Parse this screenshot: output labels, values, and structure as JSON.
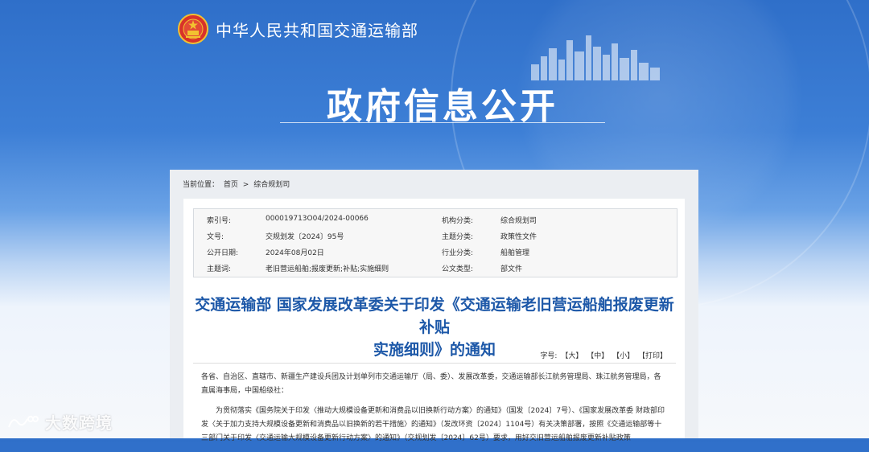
{
  "header": {
    "ministry_name": "中华人民共和国交通运输部",
    "hero_title": "政府信息公开"
  },
  "breadcrumb": {
    "label": "当前位置：",
    "items": [
      "首页",
      "综合规划司"
    ],
    "separator": ">"
  },
  "meta": {
    "rows": [
      {
        "k1": "索引号:",
        "v1": "000019713O04/2024-00066",
        "k2": "机构分类:",
        "v2": "综合规划司"
      },
      {
        "k1": "文号:",
        "v1": "交规划发〔2024〕95号",
        "k2": "主题分类:",
        "v2": "政策性文件"
      },
      {
        "k1": "公开日期:",
        "v1": "2024年08月02日",
        "k2": "行业分类:",
        "v2": "船舶管理"
      },
      {
        "k1": "主题词:",
        "v1": "老旧营运船舶;报废更新;补贴;实施细则",
        "k2": "公文类型:",
        "v2": "部文件"
      }
    ]
  },
  "document": {
    "title_line1": "交通运输部 国家发展改革委关于印发《交通运输老旧营运船舶报废更新补贴",
    "title_line2": "实施细则》的通知",
    "font_size_label": "字号:",
    "font_size_large": "【大】",
    "font_size_medium": "【中】",
    "font_size_small": "【小】",
    "print_label": "【打印】",
    "para1": "各省、自治区、直辖市、新疆生产建设兵团及计划单列市交通运输厅（局、委）、发展改革委，交通运输部长江航务管理局、珠江航务管理局，各直属海事局，中国船级社：",
    "para2": "为贯彻落实《国务院关于印发〈推动大规模设备更新和消费品以旧换新行动方案〉的通知》（国发〔2024〕7号）、《国家发展改革委 财政部印发〈关于加力支持大规模设备更新和消费品以旧换新的若干措施〉的通知》（发改环资〔2024〕1104号）有关决策部署，按照《交通运输部等十三部门关于印发〈交通运输大规模设备更新行动方案〉的通知》（交规划发〔2024〕62号）要求，用好交旧营运船舶报废更新补贴政策"
  },
  "watermark": {
    "text": "大数跨境"
  },
  "colors": {
    "title_blue": "#1d58a8",
    "hero_blue": "#2f6fc9"
  }
}
